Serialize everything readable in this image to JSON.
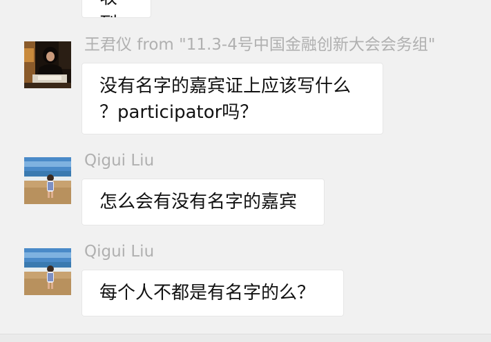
{
  "messages": [
    {
      "sender": "王君仪 from \"11.3-4号中国金融创新大会会务组\"",
      "lines": [
        "没有名字的嘉宾证上应该写什么",
        "？participator吗？"
      ]
    },
    {
      "sender": "Qigui Liu",
      "text": "怎么会有没有名字的嘉宾"
    },
    {
      "sender": "Qigui Liu",
      "text": "每个人不都是有名字的么？"
    }
  ],
  "previous_bubble_text": "收到",
  "colors": {
    "background": "#f1f1f1",
    "bubble": "#ffffff",
    "sender_name": "#b0b0b0",
    "message_text": "#111111"
  }
}
